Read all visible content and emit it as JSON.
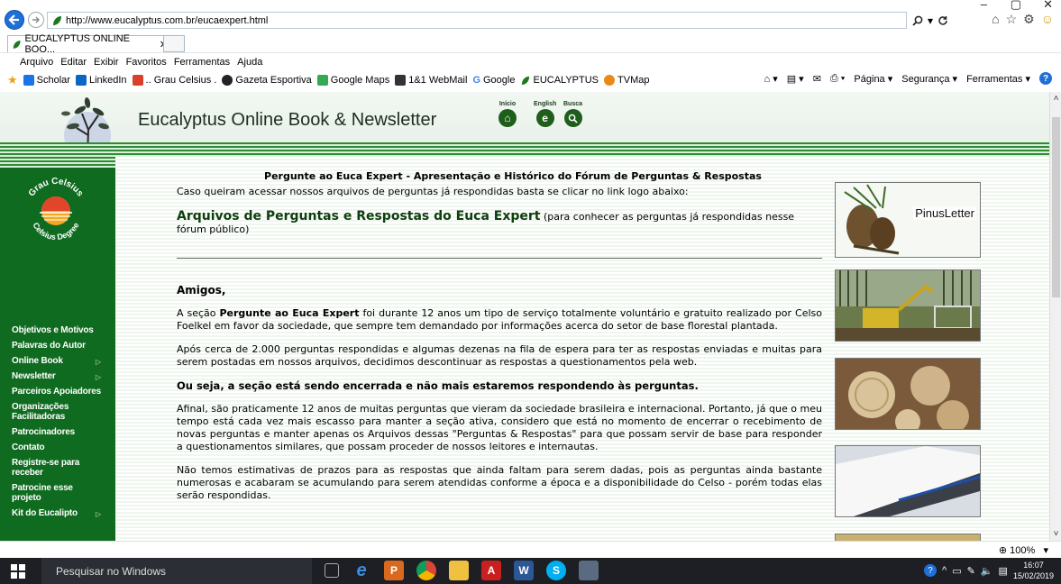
{
  "window": {
    "minimize": "–",
    "maximize": "▢",
    "close": "✕"
  },
  "address_bar": {
    "url": "http://www.eucalyptus.com.br/eucaexpert.html",
    "search_icon": "search-icon",
    "refresh_icon": "refresh-icon"
  },
  "tab": {
    "title": "EUCALYPTUS ONLINE BOO...",
    "close": "✕"
  },
  "menu": [
    "Arquivo",
    "Editar",
    "Exibir",
    "Favoritos",
    "Ferramentas",
    "Ajuda"
  ],
  "favorites": [
    {
      "label": "Scholar",
      "color": "#1a73e8"
    },
    {
      "label": "LinkedIn",
      "color": "#0a66c2"
    },
    {
      "label": ".. Grau Celsius .",
      "color": "#d8402b"
    },
    {
      "label": "Gazeta Esportiva",
      "color": "#222222"
    },
    {
      "label": "Google Maps",
      "color": "#34a853"
    },
    {
      "label": "1&1 WebMail",
      "color": "#333333"
    },
    {
      "label": "Google",
      "color": "#4285f4"
    },
    {
      "label": "EUCALYPTUS",
      "color": "#1b7a1b"
    },
    {
      "label": "TVMap",
      "color": "#e88a1a"
    }
  ],
  "command_bar": {
    "page": "Página ▾",
    "security": "Segurança ▾",
    "tools": "Ferramentas ▾"
  },
  "site": {
    "title": "Eucalyptus Online Book & Newsletter",
    "nav": [
      {
        "label": "Início",
        "icon": "home-icon"
      },
      {
        "label": "English",
        "icon": "english-icon"
      },
      {
        "label": "Busca",
        "icon": "search-icon"
      }
    ]
  },
  "sidebar": {
    "logo_top": "Grau Celsius",
    "logo_bottom": "Celsius Degree",
    "items": [
      {
        "label": "Objetivos e Motivos",
        "arrow": ""
      },
      {
        "label": "Palavras do Autor",
        "arrow": ""
      },
      {
        "label": "Online Book",
        "arrow": "▷"
      },
      {
        "label": "Newsletter",
        "arrow": "▷"
      },
      {
        "label": "Parceiros Apoiadores",
        "arrow": ""
      },
      {
        "label": "Organizações Facilitadoras",
        "arrow": ""
      },
      {
        "label": "Patrocinadores",
        "arrow": ""
      },
      {
        "label": "Contato",
        "arrow": ""
      },
      {
        "label": "Registre-se para receber",
        "arrow": ""
      },
      {
        "label": "Patrocine esse projeto",
        "arrow": ""
      },
      {
        "label": "Kit do Eucalipto",
        "arrow": "▷"
      }
    ]
  },
  "content": {
    "title": "Pergunte ao Euca Expert - Apresentação e Histórico do Fórum de Perguntas & Respostas",
    "intro": "Caso queiram acessar nossos arquivos de perguntas já respondidas basta se clicar no link logo abaixo:",
    "link_big": "Arquivos de Perguntas e Respostas do Euca Expert",
    "link_small": " (para conhecer as perguntas já respondidas nesse fórum público)",
    "greeting": "Amigos,",
    "p1_before": "A seção ",
    "p1_bold": "Pergunte ao Euca Expert",
    "p1_after": " foi durante 12 anos um tipo de serviço totalmente voluntário e gratuito realizado por Celso Foelkel em favor da sociedade, que sempre tem demandado por informações acerca do setor de base florestal plantada.",
    "p2": "Após cerca de 2.000 perguntas respondidas e algumas dezenas na fila de espera para ter as respostas enviadas e muitas para serem postadas em nossos arquivos, decidimos descontinuar as respostas a questionamentos pela web.",
    "p3": "Ou seja, a seção está sendo encerrada e não mais estaremos respondendo às perguntas.",
    "p4": "Afinal, são praticamente 12 anos de muitas perguntas que vieram da sociedade brasileira e internacional. Portanto, já que o meu tempo está cada vez mais escasso para manter a seção ativa, considero que está no momento de encerrar o recebimento de novas perguntas e manter apenas os Arquivos dessas \"Perguntas & Respostas\" para que possam servir de base para responder a questionamentos similares, que possam proceder de nossos leitores e internautas.",
    "p5": "Não temos estimativas de prazos para as respostas que ainda faltam para serem dadas, pois as perguntas ainda bastante numerosas e acabaram se acumulando para serem atendidas conforme a época e a disponibilidade do Celso - porém todas elas serão respondidas."
  },
  "right_pictures": {
    "pinus_label": "PinusLetter"
  },
  "status_bar": {
    "zoom": "100%"
  },
  "taskbar": {
    "search_placeholder": "Pesquisar no Windows",
    "time": "16:07",
    "date": "15/02/2019"
  }
}
